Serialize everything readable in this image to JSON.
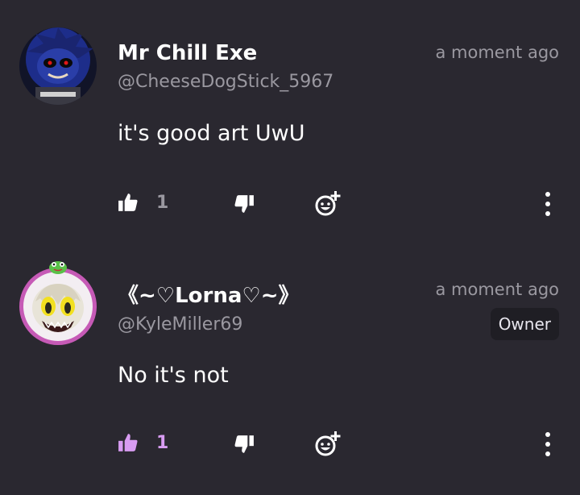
{
  "colors": {
    "background": "#2a2830",
    "muted_text": "#9a98a0",
    "liked_accent": "#d89cf2",
    "default_icon": "#ffffff"
  },
  "comments": [
    {
      "author": "Mr Chill Exe",
      "handle": "@CheeseDogStick_5967",
      "timestamp": "a moment ago",
      "text": "it's good art UwU",
      "like_count": "1",
      "liked": false,
      "badge": null
    },
    {
      "author": "《~♡Lorna♡~》",
      "handle": "@KyleMiller69",
      "timestamp": "a moment ago",
      "text": "No it's not",
      "like_count": "1",
      "liked": true,
      "badge": "Owner"
    }
  ],
  "icons": {
    "like": "thumbs-up-icon",
    "dislike": "thumbs-down-icon",
    "react": "add-reaction-icon",
    "more": "more-options-icon"
  }
}
